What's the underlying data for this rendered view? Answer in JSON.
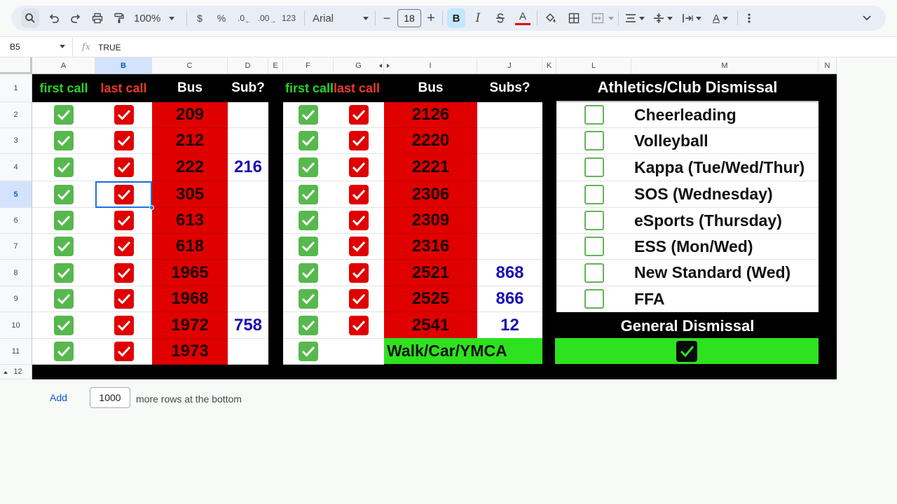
{
  "toolbar": {
    "zoom": "100%",
    "currency": "$",
    "percent": "%",
    "dec_decrease": ".0",
    "dec_increase": ".00",
    "number_format": "123",
    "font_family": "Arial",
    "font_size": "18",
    "bold": "B",
    "italic": "I",
    "text_color_letter": "A",
    "text_color": "#e00000",
    "minus": "−",
    "plus": "+"
  },
  "formula_bar": {
    "cell_ref": "B5",
    "fx": "fx",
    "value": "TRUE"
  },
  "columns": [
    "A",
    "B",
    "C",
    "D",
    "E",
    "F",
    "G",
    "I",
    "J",
    "K",
    "L",
    "M",
    "N"
  ],
  "rows": [
    "1",
    "2",
    "3",
    "4",
    "5",
    "6",
    "7",
    "8",
    "9",
    "10",
    "11",
    "12"
  ],
  "headers": {
    "first_call": "first call",
    "last_call": "last call",
    "bus": "Bus",
    "sub": "Sub?",
    "first_call_2": "first call",
    "last_call_2": "last call",
    "bus_2": "Bus",
    "subs_2": "Subs?",
    "athletics": "Athletics/Club Dismissal",
    "general": "General Dismissal"
  },
  "left_table": {
    "buses": [
      "209",
      "212",
      "222",
      "305",
      "613",
      "618",
      "1965",
      "1968",
      "1972",
      "1973"
    ],
    "subs": [
      "",
      "",
      "216",
      "",
      "",
      "",
      "",
      "",
      "758",
      ""
    ],
    "first_call_checked": [
      true,
      true,
      true,
      true,
      true,
      true,
      true,
      true,
      true,
      true
    ],
    "last_call_checked": [
      true,
      true,
      true,
      true,
      true,
      true,
      true,
      true,
      true,
      true
    ]
  },
  "middle_table": {
    "buses": [
      "2126",
      "2220",
      "2221",
      "2306",
      "2309",
      "2316",
      "2521",
      "2525",
      "2541"
    ],
    "subs": [
      "",
      "",
      "",
      "",
      "",
      "",
      "868",
      "866",
      "12"
    ],
    "first_call_checked": [
      true,
      true,
      true,
      true,
      true,
      true,
      true,
      true,
      true,
      true
    ],
    "last_call_checked": [
      true,
      true,
      true,
      true,
      true,
      true,
      true,
      true,
      true,
      false
    ],
    "walk_label": "Walk/Car/YMCA"
  },
  "athletics": {
    "items": [
      "Cheerleading",
      "Volleyball",
      "Kappa (Tue/Wed/Thur)",
      "SOS (Wednesday)",
      "eSports (Thursday)",
      "ESS (Mon/Wed)",
      "New Standard (Wed)",
      "FFA"
    ],
    "checked": [
      false,
      false,
      false,
      false,
      false,
      false,
      false,
      false
    ]
  },
  "general_dismissal_checked": true,
  "footer": {
    "add_label": "Add",
    "rows_value": "1000",
    "more_rows_text": "more rows at the bottom"
  },
  "colors": {
    "header_bg": "#000000",
    "bus_bg": "#e00000",
    "first_call_check": "#57b84d",
    "walk_bg": "#2ee21f",
    "sub_text": "#1a0fb4",
    "selection": "#1a73e8"
  }
}
